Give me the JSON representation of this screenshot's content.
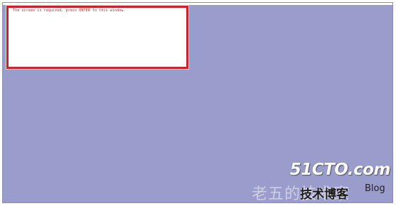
{
  "message_window": {
    "text": "The screen is required, press ENTER to this window."
  },
  "watermark": {
    "logo": "51CTO.com",
    "blog_cn": "技术博客",
    "blog_en": "Blog",
    "author": "老五的技术家"
  },
  "colors": {
    "desktop": "#9a9ccc",
    "window_border": "#c8222a",
    "message_text": "#c8222a"
  }
}
